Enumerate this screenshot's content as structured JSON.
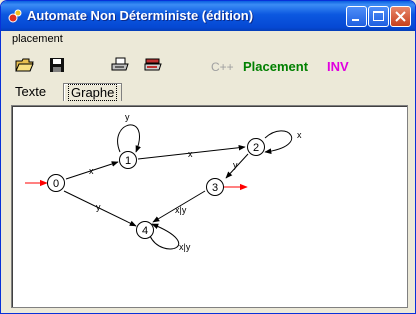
{
  "window": {
    "title": "Automate Non Déterministe (édition)"
  },
  "menu": {
    "items": [
      "placement"
    ]
  },
  "toolbar": {
    "cpp_label": "C++",
    "placement_label": "Placement",
    "inv_label": "INV"
  },
  "tabs": [
    {
      "label": "Texte"
    },
    {
      "label": "Graphe"
    }
  ],
  "graph": {
    "states": [
      "0",
      "1",
      "2",
      "3",
      "4"
    ],
    "initial_state": "0",
    "final_state": "3",
    "transitions": [
      {
        "from": "0",
        "to": "1",
        "label": "x"
      },
      {
        "from": "0",
        "to": "4",
        "label": "y"
      },
      {
        "from": "1",
        "to": "1",
        "label": "y"
      },
      {
        "from": "1",
        "to": "2",
        "label": "x"
      },
      {
        "from": "2",
        "to": "2",
        "label": "x"
      },
      {
        "from": "2",
        "to": "3",
        "label": "y"
      },
      {
        "from": "3",
        "to": "4",
        "label": "x|y"
      },
      {
        "from": "4",
        "to": "4",
        "label": "x|y"
      }
    ],
    "colors": {
      "arrow_accent": "#ff0000"
    }
  }
}
